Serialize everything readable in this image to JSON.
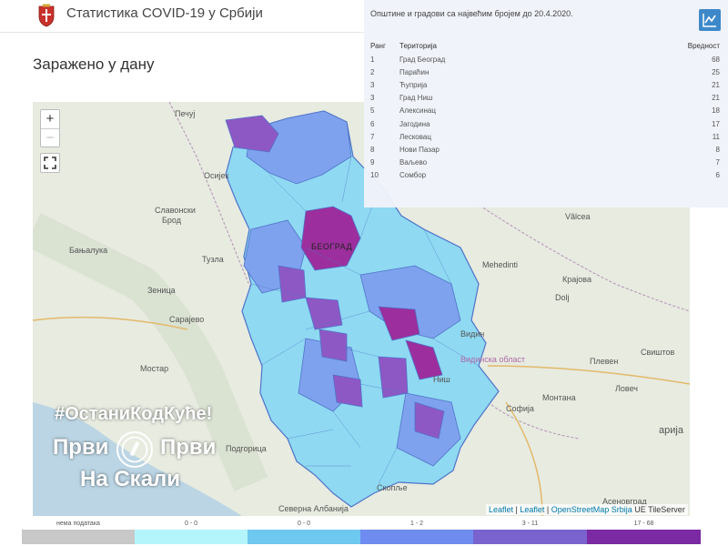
{
  "header": {
    "title": "Статистика COVID-19 у Србији",
    "crest_icon": "serbia-coat-of-arms-icon",
    "chart_toggle_icon": "line-chart-icon"
  },
  "subtitle": "Заражено у дану",
  "map": {
    "zoom_in": "+",
    "zoom_out": "−",
    "fullscreen_icon": "fullscreen-icon",
    "labels": {
      "pecuj": "Печуј",
      "osijek": "Осијек",
      "slavonski": "Славонски",
      "brod": "Брод",
      "banjaluka": "Бањалука",
      "tuzla": "Тузла",
      "zenica": "Зеница",
      "sarajevo": "Сарајево",
      "mostar": "Мостар",
      "podgorica": "Подгорица",
      "beograd": "БЕОГРАД",
      "albania": "Северна Албанија",
      "vidin": "Видинска област",
      "montana": "Монтана",
      "sofija": "Софија",
      "bugarska": "арија",
      "kraiova": "Крајова",
      "vidin_city": "Видин",
      "pleven": "Плевен",
      "lovech": "Ловеч",
      "svishtov": "Свиштов",
      "mehedinti": "Mehedinti",
      "dolj": "Dolj",
      "valcea": "Vâlcea",
      "skopje": "Скопље",
      "nis": "Ниш",
      "asenovgrad": "Асеновград"
    },
    "attribution": {
      "leaflet1": "Leaflet",
      "sep": " | ",
      "leaflet2": "Leaflet",
      "osm": "OpenStreetMap Srbija",
      "rest": " UE TileServer"
    }
  },
  "branding": {
    "hashtag": "#ОстаниКодКуће!",
    "left": "Први",
    "right": "Први",
    "bottom": "На Скали"
  },
  "ranking": {
    "title": "Општине и градови са највећим бројем до 20.4.2020.",
    "headers": {
      "rank": "Ранг",
      "territory": "Територија",
      "value": "Вредност"
    },
    "rows": [
      {
        "rank": "1",
        "territory": "Град Београд",
        "value": "68"
      },
      {
        "rank": "2",
        "territory": "Параћин",
        "value": "25"
      },
      {
        "rank": "3",
        "territory": "Ћуприја",
        "value": "21"
      },
      {
        "rank": "3",
        "territory": "Град Ниш",
        "value": "21"
      },
      {
        "rank": "5",
        "territory": "Алексинац",
        "value": "18"
      },
      {
        "rank": "6",
        "territory": "Јагодина",
        "value": "17"
      },
      {
        "rank": "7",
        "territory": "Лесковац",
        "value": "11"
      },
      {
        "rank": "8",
        "territory": "Нови Пазар",
        "value": "8"
      },
      {
        "rank": "9",
        "territory": "Ваљево",
        "value": "7"
      },
      {
        "rank": "10",
        "territory": "Сомбор",
        "value": "6"
      }
    ]
  },
  "legend": [
    {
      "label": "нема података",
      "color": "#c8c8c8"
    },
    {
      "label": "0 - 0",
      "color": "#b3f5fb"
    },
    {
      "label": "0 - 0",
      "color": "#6ec8ef"
    },
    {
      "label": "1 - 2",
      "color": "#6f8cf0"
    },
    {
      "label": "3 - 11",
      "color": "#7a63cf"
    },
    {
      "label": "17 - 68",
      "color": "#7b2aa3"
    }
  ],
  "colors": {
    "accent": "#3d88c9",
    "region_light": "#8fd9f2",
    "region_mid": "#7fa2ee",
    "region_dark": "#8e58c4",
    "region_max": "#9c2f9d"
  }
}
